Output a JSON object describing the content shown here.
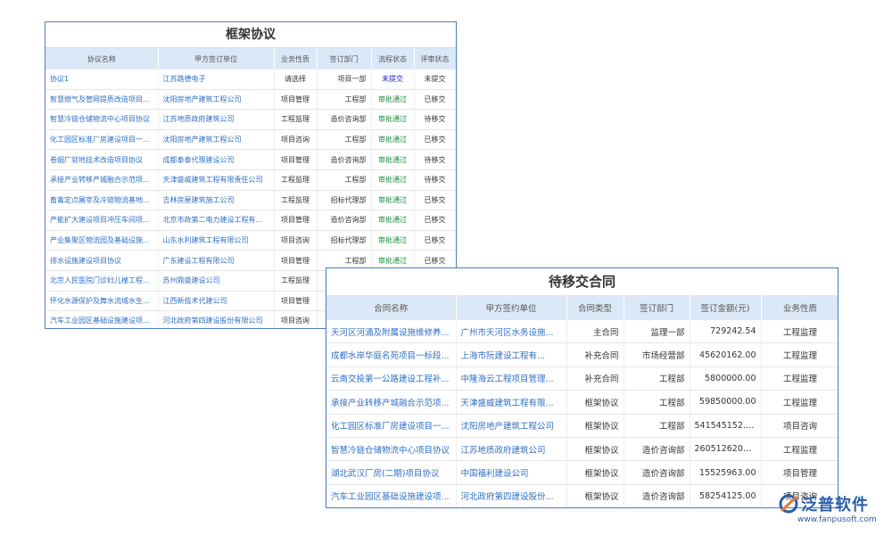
{
  "framework": {
    "title": "框架协议",
    "columns": [
      "协议名称",
      "甲方签订单位",
      "业务性质",
      "签订部门",
      "流程状态",
      "评审状态"
    ],
    "rows": [
      {
        "name": "协议1",
        "party": "江苏路德电子",
        "nature": "请选择",
        "dept": "项目一部",
        "flow": "未提交",
        "review": "未提交"
      },
      {
        "name": "智慧燃气及管网提质改造项目...",
        "party": "沈阳房地产建筑工程公司",
        "nature": "项目管理",
        "dept": "工程部",
        "flow": "审批通过",
        "review": "已移交"
      },
      {
        "name": "智慧冷链仓储物流中心项目协议",
        "party": "江苏地质政府建筑公司",
        "nature": "工程监理",
        "dept": "造价咨询部",
        "flow": "审批通过",
        "review": "待移交"
      },
      {
        "name": "化工园区标准厂房建设项目一...",
        "party": "沈阳房地产建筑工程公司",
        "nature": "项目咨询",
        "dept": "工程部",
        "flow": "审批通过",
        "review": "已移交"
      },
      {
        "name": "卷烟厂就地技术改造项目协议",
        "party": "成都泰泰代理建设公司",
        "nature": "项目管理",
        "dept": "造价咨询部",
        "flow": "审批通过",
        "review": "待移交"
      },
      {
        "name": "承接产业转移产城融合示范项...",
        "party": "天津盛威建筑工程有限责任公司",
        "nature": "工程监理",
        "dept": "工程部",
        "flow": "审批通过",
        "review": "待移交"
      },
      {
        "name": "畜禽定点屠宰及冷链物流基地...",
        "party": "吉林房屋建筑施工公司",
        "nature": "工程监理",
        "dept": "招标代理部",
        "flow": "审批通过",
        "review": "已移交"
      },
      {
        "name": "产能扩大建设项目冲压车间项...",
        "party": "北京市政第二电力建设工程有...",
        "nature": "项目管理",
        "dept": "造价咨询部",
        "flow": "审批通过",
        "review": "已移交"
      },
      {
        "name": "产业集聚区物流园及基础设施...",
        "party": "山东水利建筑工程有限公司",
        "nature": "项目咨询",
        "dept": "招标代理部",
        "flow": "审批通过",
        "review": "已移交"
      },
      {
        "name": "排水设施建设项目协议",
        "party": "广东建设工程有限公司",
        "nature": "项目管理",
        "dept": "工程部",
        "flow": "审批通过",
        "review": "已移交"
      },
      {
        "name": "北京人民医院门诊妇儿楼工程...",
        "party": "苏州鼎盛建设公司",
        "nature": "工程监理",
        "dept": "",
        "flow": "",
        "review": ""
      },
      {
        "name": "怀化水源保护及舞水流域水生...",
        "party": "江西新技术代建公司",
        "nature": "项目管理",
        "dept": "",
        "flow": "",
        "review": ""
      },
      {
        "name": "汽车工业园区基础设施建设项...",
        "party": "河北政府第四建设股份有限公司",
        "nature": "项目咨询",
        "dept": "",
        "flow": "",
        "review": ""
      }
    ]
  },
  "pending": {
    "title": "待移交合同",
    "columns": [
      "合同名称",
      "甲方签约单位",
      "合同类型",
      "签订部门",
      "签订金额(元)",
      "业务性质"
    ],
    "rows": [
      {
        "name": "天河区河涌及附属设施维修养...",
        "party": "广州市天河区水务设施...",
        "type": "主合同",
        "dept": "监理一部",
        "amount": "729242.54",
        "nature": "工程监理"
      },
      {
        "name": "成都水岸华庭名苑项目一标段...",
        "party": "上海市阮建设工程有...",
        "type": "补充合同",
        "dept": "市场经营部",
        "amount": "45620162.00",
        "nature": "工程监理"
      },
      {
        "name": "云南交投第一公路建设工程补...",
        "party": "中隆海云工程项目管理...",
        "type": "补充合同",
        "dept": "工程部",
        "amount": "5800000.00",
        "nature": "工程监理"
      },
      {
        "name": "承接产业转移产城融合示范项...",
        "party": "天津盛威建筑工程有限...",
        "type": "框架协议",
        "dept": "工程部",
        "amount": "59850000.00",
        "nature": "工程监理"
      },
      {
        "name": "化工园区标准厂房建设项目一...",
        "party": "沈阳房地产建筑工程公司",
        "type": "框架协议",
        "dept": "工程部",
        "amount": "541545152.00",
        "nature": "项目咨询"
      },
      {
        "name": "智慧冷链仓储物流中心项目协议",
        "party": "江苏地质政府建筑公司",
        "type": "框架协议",
        "dept": "造价咨询部",
        "amount": "2605126200...",
        "nature": "工程监理"
      },
      {
        "name": "湖北武汉厂房(二期)项目协议",
        "party": "中国福利建设公司",
        "type": "框架协议",
        "dept": "造价咨询部",
        "amount": "15525963.00",
        "nature": "项目管理"
      },
      {
        "name": "汽车工业园区基础设施建设项...",
        "party": "河北政府第四建设股份...",
        "type": "框架协议",
        "dept": "造价咨询部",
        "amount": "58254125.00",
        "nature": "项目咨询"
      }
    ]
  },
  "logo": {
    "name": "泛普软件",
    "url": "www.fanpusoft.com",
    "icon": "fanpu-logo-icon",
    "color": "#2a5fa8"
  }
}
